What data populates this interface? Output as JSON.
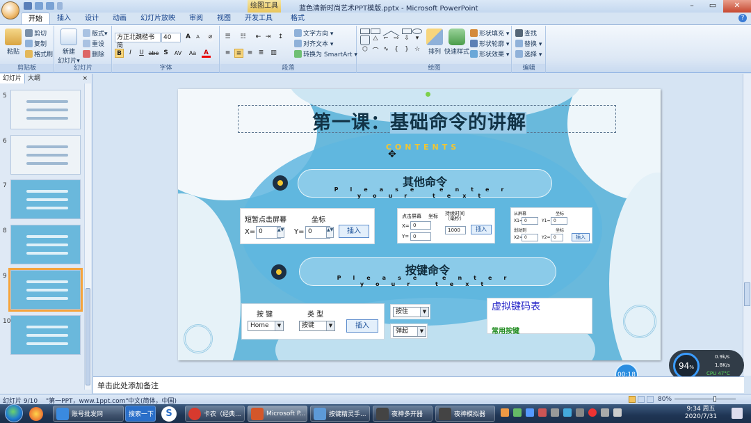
{
  "window": {
    "title": "蓝色清新时尚艺术PPT模版.pptx - Microsoft PowerPoint",
    "context_tab": "绘图工具",
    "minimize": "–",
    "maximize": "▭",
    "close": "✕"
  },
  "ribbon_tabs": [
    "开始",
    "插入",
    "设计",
    "动画",
    "幻灯片放映",
    "审阅",
    "视图",
    "开发工具",
    "格式"
  ],
  "ribbon": {
    "clipboard": {
      "label": "剪贴板",
      "paste": "粘贴",
      "cut": "剪切",
      "copy": "复制",
      "format_painter": "格式刷"
    },
    "slides": {
      "label": "幻灯片",
      "new_slide": "新建\n幻灯片▾",
      "layout": "版式▾",
      "reset": "重设",
      "delete": "删除"
    },
    "font": {
      "label": "字体",
      "font_name": "方正北魏楷书简",
      "font_size": "40",
      "bold": "B",
      "italic": "I",
      "underline": "U",
      "strike": "abe",
      "shadow": "S",
      "spacing": "AV",
      "case": "Aa",
      "color": "A",
      "grow": "A",
      "shrink": "A"
    },
    "paragraph": {
      "label": "段落",
      "text_direction": "文字方向 ▾",
      "align_text": "对齐文本 ▾",
      "smartart": "转换为 SmartArt ▾"
    },
    "drawing": {
      "label": "绘图",
      "arrange": "排列",
      "quick_styles": "快速样式",
      "shape_fill": "形状填充 ▾",
      "shape_outline": "形状轮廓 ▾",
      "shape_effects": "形状效果 ▾"
    },
    "editing": {
      "label": "编辑",
      "find": "查找",
      "replace": "替换 ▾",
      "select": "选择 ▾"
    }
  },
  "left_pane": {
    "tab_slides": "幻灯片",
    "tab_outline": "大纲",
    "close": "×",
    "slide_numbers": [
      "5",
      "6",
      "7",
      "8",
      "9",
      "10"
    ],
    "selected_index": 4
  },
  "slide": {
    "title_part1": "第一课：",
    "title_part2": "基础命令的讲解",
    "subtitle": "CONTENTS",
    "section1": {
      "title": "其他命令",
      "sub": "Please enter your text"
    },
    "section2": {
      "title": "按键命令",
      "sub": "Please enter your text"
    },
    "panel_a": {
      "title": "短暂点击屏幕",
      "coord": "坐标",
      "x_label": "X=",
      "x_val": "0",
      "y_label": "Y=",
      "y_val": "0",
      "insert": "插入"
    },
    "panel_b": {
      "title": "点击屏幕",
      "coord": "坐标",
      "duration": "持续时间\n（毫秒）",
      "x_label": "X=",
      "x_val": "0",
      "y_label": "Y=",
      "y_val": "0",
      "duration_val": "1000",
      "insert": "插入"
    },
    "panel_c": {
      "from": "从屏幕",
      "coord1": "坐标",
      "x1_label": "X1=",
      "x1_val": "0",
      "y1_label": "Y1=",
      "y1_val": "0",
      "slide_to": "划动到",
      "coord2": "坐标",
      "x2_label": "X2=",
      "x2_val": "0",
      "y2_label": "Y2=",
      "y2_val": "0",
      "insert": "插入"
    },
    "panel_d": {
      "key_label": "按 键",
      "type_label": "类 型",
      "key_val": "Home",
      "type_val": "按键",
      "insert": "插入"
    },
    "press_hold": "按住",
    "release": "弹起",
    "vk_table": "虚拟键码表",
    "common_keys": "常用按键"
  },
  "notes": {
    "placeholder": "单击此处添加备注"
  },
  "status": {
    "slide_pos": "幻灯片 9/10",
    "theme": "\"第一PPT，www.1ppt.com\"",
    "language": "中文(简体，中国)",
    "zoom": "80%"
  },
  "overlays": {
    "timer": "00:18",
    "gauge": "94",
    "gauge_unit": "%",
    "net_up": "0.9k/s",
    "net_down": "1.8K/s",
    "cpu": "CPU 47°C"
  },
  "taskbar": {
    "items": [
      "账号批发网",
      "搜索一下",
      "卡农（经典...",
      "Microsoft P...",
      "按键精灵手...",
      "夜神多开器",
      "夜神模拟器"
    ],
    "time": "9:34 周五",
    "date": "2020/7/31"
  }
}
